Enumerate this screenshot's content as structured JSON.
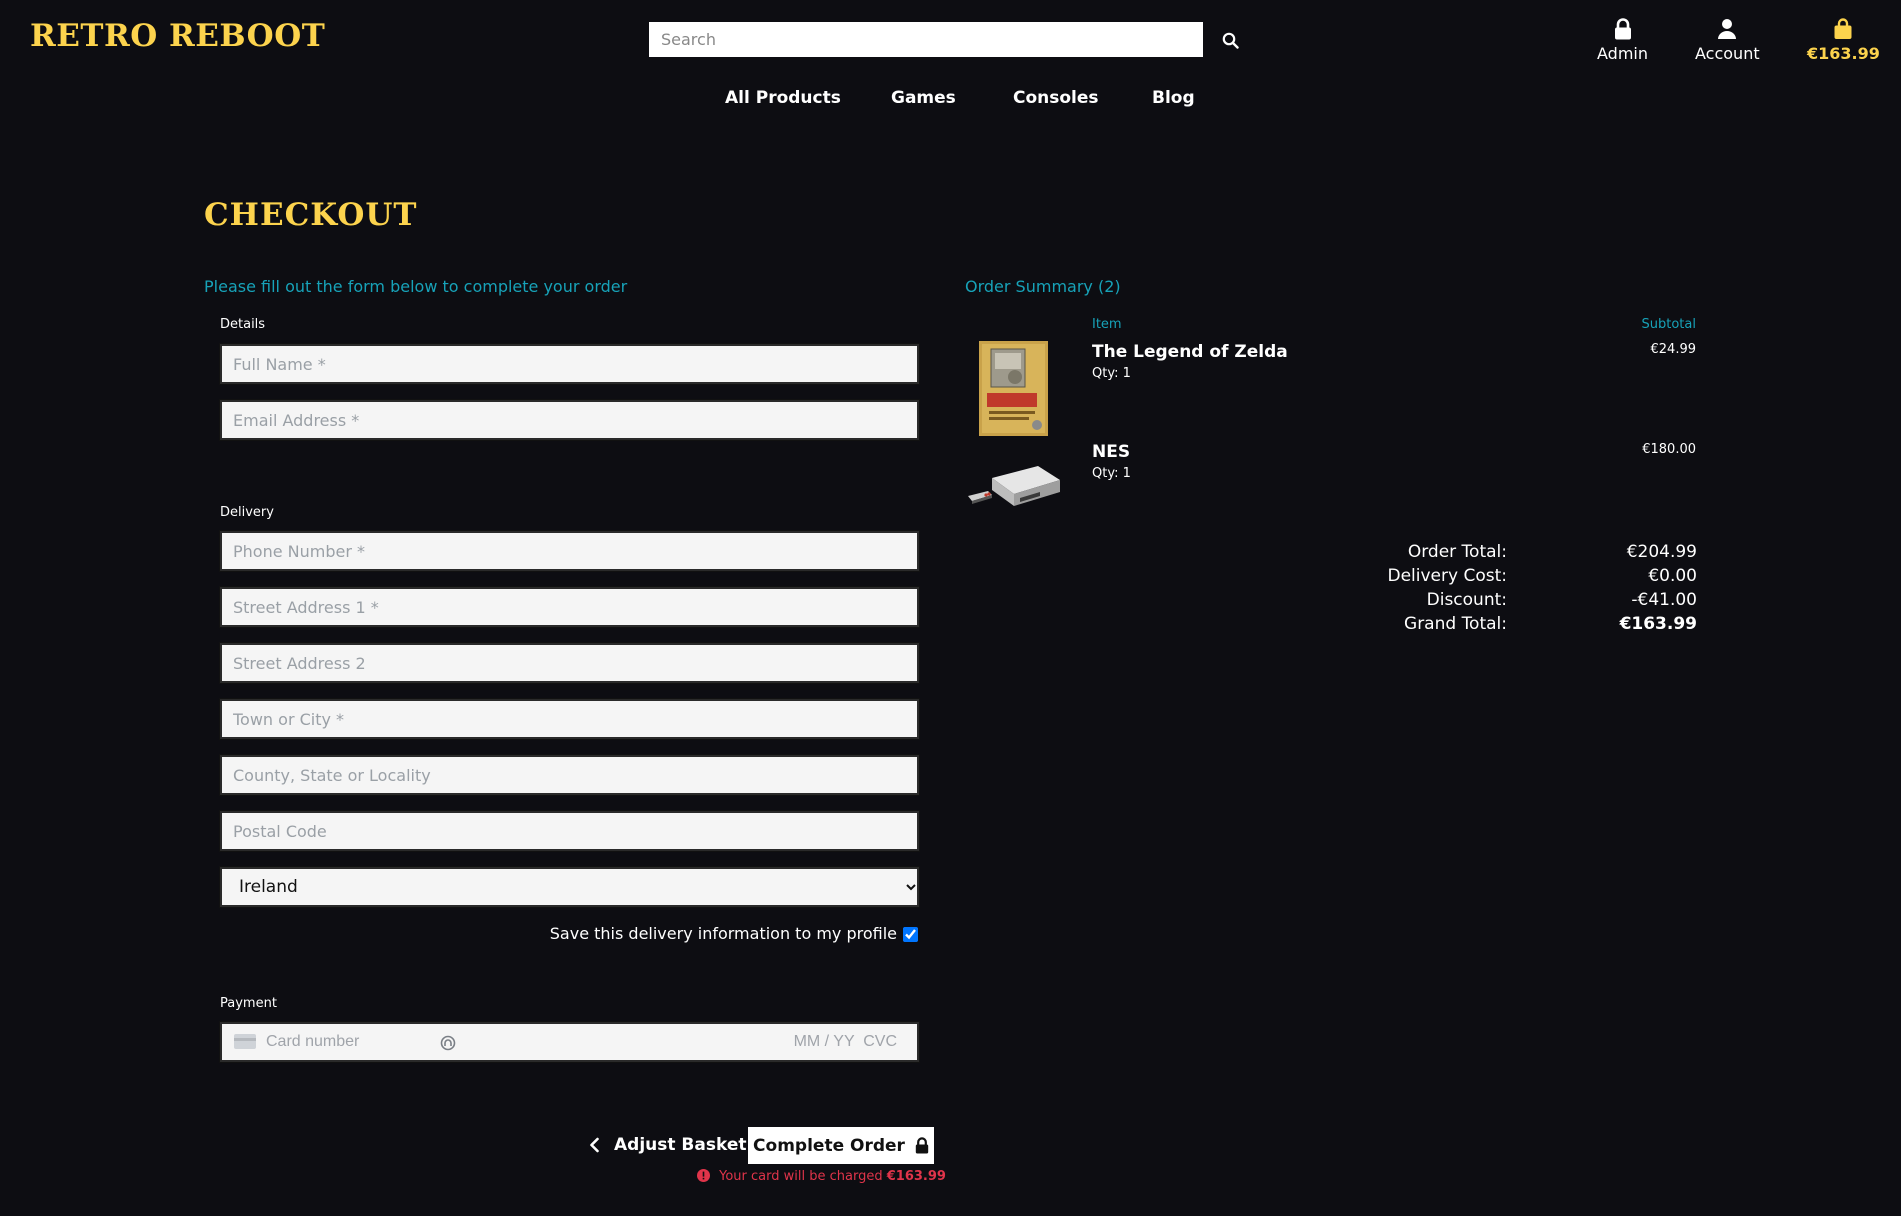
{
  "header": {
    "logo": "RETRO REBOOT",
    "search_placeholder": "Search",
    "admin_label": "Admin",
    "account_label": "Account",
    "basket_total": "€163.99"
  },
  "nav": {
    "items": [
      "All Products",
      "Games",
      "Consoles",
      "Blog"
    ]
  },
  "page": {
    "title": "CHECKOUT",
    "intro": "Please fill out the form below to complete your order"
  },
  "form": {
    "details_label": "Details",
    "delivery_label": "Delivery",
    "payment_label": "Payment",
    "full_name_placeholder": "Full Name *",
    "email_placeholder": "Email Address *",
    "phone_placeholder": "Phone Number *",
    "street1_placeholder": "Street Address 1 *",
    "street2_placeholder": "Street Address 2",
    "town_placeholder": "Town or City *",
    "county_placeholder": "County, State or Locality",
    "postcode_placeholder": "Postal Code",
    "country_selected": "Ireland",
    "save_info_label": "Save this delivery information to my profile",
    "save_info_checked": true,
    "card_placeholder": "Card number",
    "card_expiry_cvc": "MM / YY  CVC"
  },
  "actions": {
    "adjust_label": "Adjust Basket",
    "complete_label": "Complete Order",
    "charge_text": "Your card will be charged",
    "charge_amount": "€163.99"
  },
  "summary": {
    "title": "Order Summary (2)",
    "col_item": "Item",
    "col_subtotal": "Subtotal",
    "items": [
      {
        "name": "The Legend of Zelda",
        "qty": "Qty: 1",
        "subtotal": "€24.99"
      },
      {
        "name": "NES",
        "qty": "Qty: 1",
        "subtotal": "€180.00"
      }
    ],
    "totals": {
      "order_total_label": "Order Total:",
      "order_total": "€204.99",
      "delivery_label": "Delivery Cost:",
      "delivery": "€0.00",
      "discount_label": "Discount:",
      "discount": "-€41.00",
      "grand_label": "Grand Total:",
      "grand": "€163.99"
    }
  },
  "colors": {
    "background": "#0d0d12",
    "brand_yellow": "#fcd34d",
    "accent_teal": "#17a2b8",
    "error_red": "#e0344a"
  }
}
